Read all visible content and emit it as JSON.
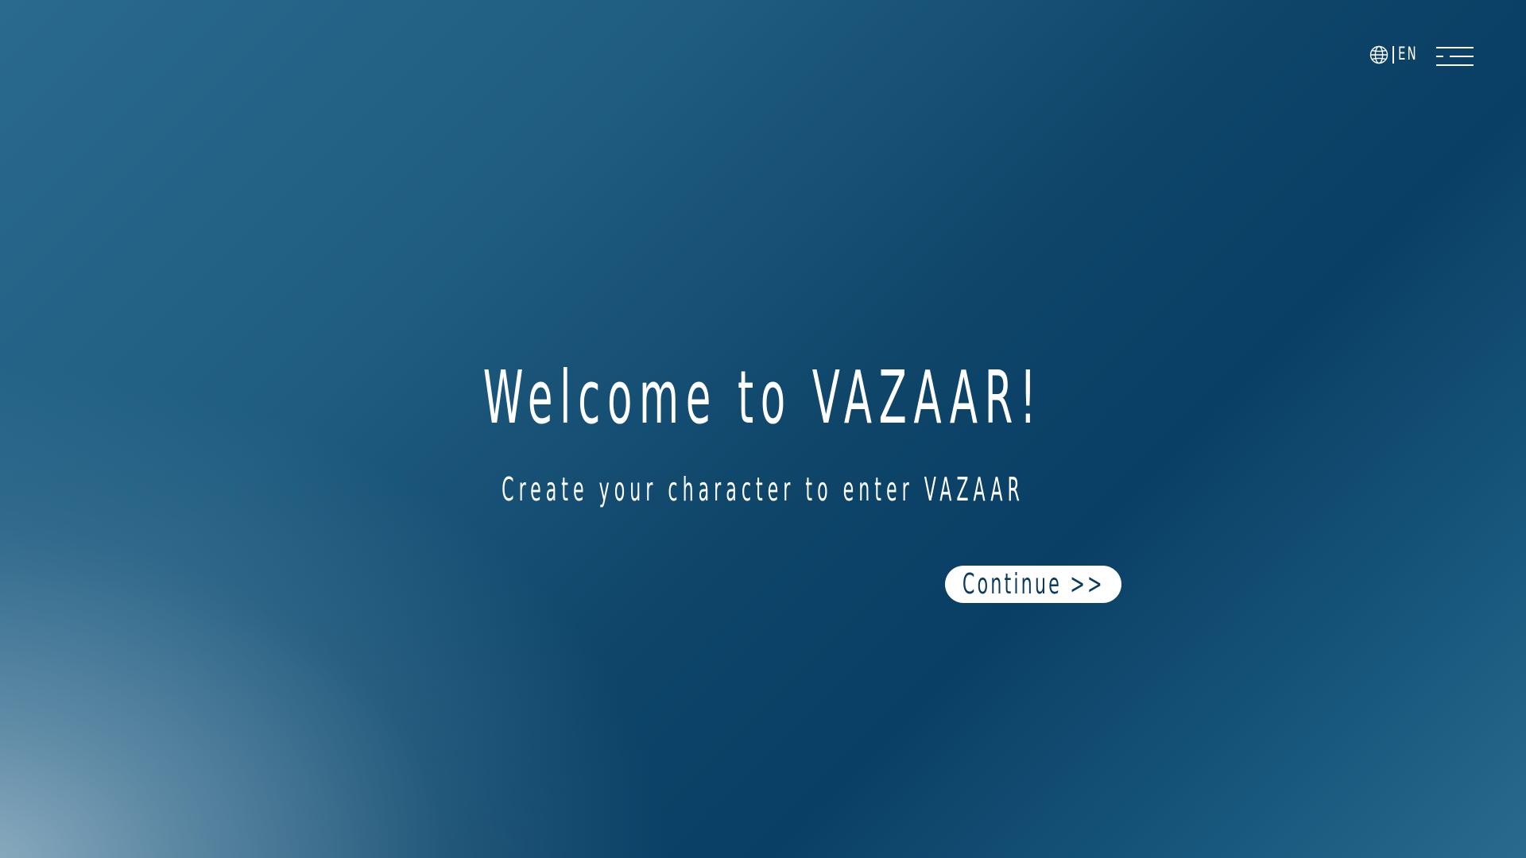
{
  "header": {
    "language": {
      "icon": "globe-icon",
      "code": "EN"
    },
    "menu": {
      "icon": "menu-icon"
    }
  },
  "hero": {
    "title": "Welcome to VAZAAR!",
    "subtitle": "Create your character to enter VAZAAR",
    "cta_label": "Continue >>"
  },
  "colors": {
    "background_dark": "#0a3f65",
    "background_light": "#8fb0c6",
    "text": "#ffffff",
    "button_bg": "#ffffff",
    "button_text": "#0b3a5e"
  }
}
